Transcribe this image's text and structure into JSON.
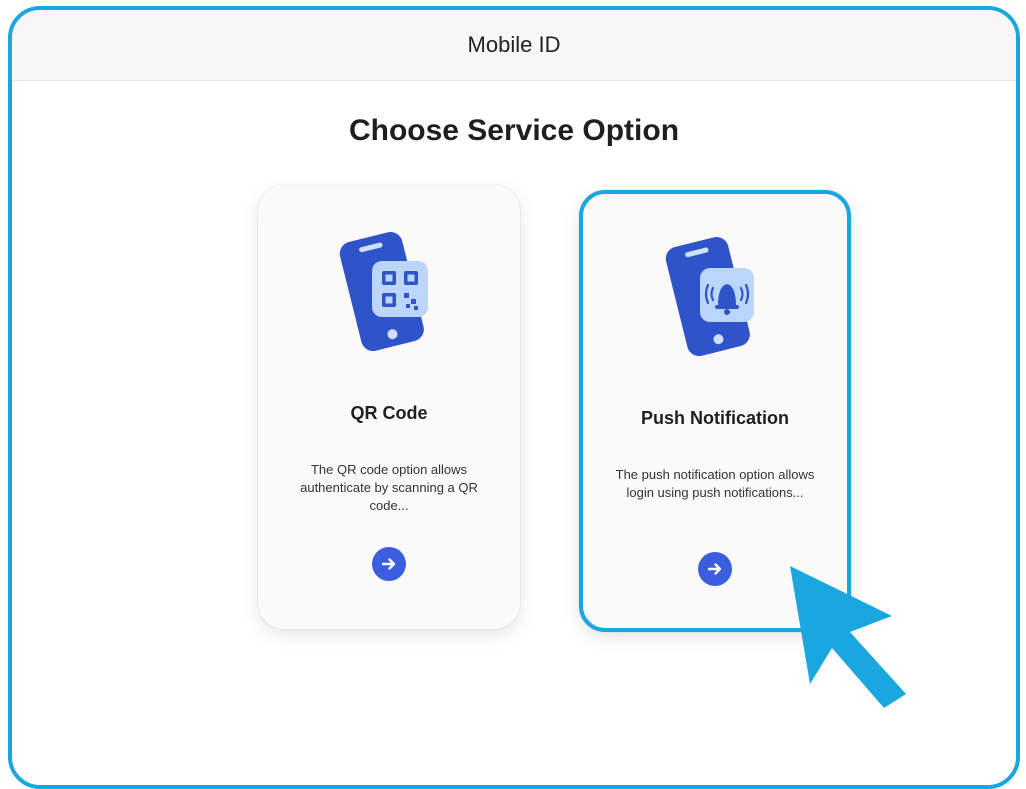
{
  "window": {
    "title": "Mobile ID"
  },
  "page": {
    "heading": "Choose Service Option"
  },
  "options": [
    {
      "title": "QR Code",
      "description": "The QR code option allows authenticate by scanning a QR code...",
      "icon": "phone-qr-code-icon",
      "action_icon": "arrow-right-icon"
    },
    {
      "title": "Push Notification",
      "description": "The push notification option allows login using push notifications...",
      "icon": "phone-bell-notification-icon",
      "action_icon": "arrow-right-icon",
      "highlighted": true
    }
  ],
  "colors": {
    "accent_border": "#1aa6de",
    "button": "#3b5ee0",
    "phone": "#2f53c9",
    "cursor": "#1aa6de"
  },
  "cursor": {
    "icon": "mouse-pointer-icon"
  }
}
